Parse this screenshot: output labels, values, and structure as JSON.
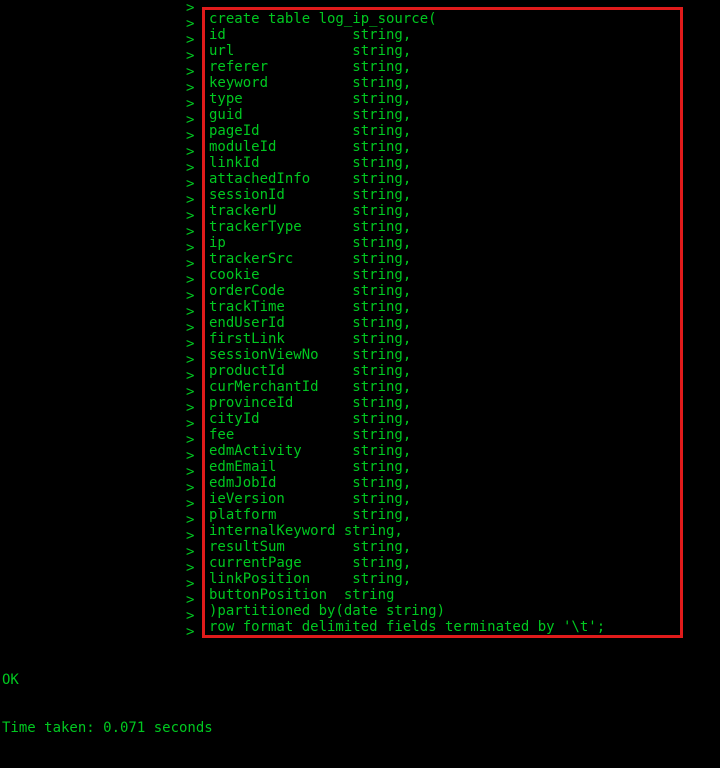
{
  "terminal": {
    "background_color": "#000000",
    "text_color": "#00c820",
    "highlight_color": "#e01b1b",
    "continuation_prompt": ">"
  },
  "sql": {
    "lines": [
      "create table log_ip_source(",
      "id               string,",
      "url              string,",
      "referer          string,",
      "keyword          string,",
      "type             string,",
      "guid             string,",
      "pageId           string,",
      "moduleId         string,",
      "linkId           string,",
      "attachedInfo     string,",
      "sessionId        string,",
      "trackerU         string,",
      "trackerType      string,",
      "ip               string,",
      "trackerSrc       string,",
      "cookie           string,",
      "orderCode        string,",
      "trackTime        string,",
      "endUserId        string,",
      "firstLink        string,",
      "sessionViewNo    string,",
      "productId        string,",
      "curMerchantId    string,",
      "provinceId       string,",
      "cityId           string,",
      "fee              string,",
      "edmActivity      string,",
      "edmEmail         string,",
      "edmJobId         string,",
      "ieVersion        string,",
      "platform         string,",
      "internalKeyword string,",
      "resultSum        string,",
      "currentPage      string,",
      "linkPosition     string,",
      "buttonPosition  string",
      ")partitioned by(date string)",
      "row format delimited fields terminated by '\\t';"
    ],
    "table_name": "log_ip_source",
    "column_type": "string",
    "partition_clause": ")partitioned by(date string)",
    "row_format_clause": "row format delimited fields terminated by '\\t';"
  },
  "result": {
    "status": "OK",
    "timing": "Time taken: 0.071 seconds"
  }
}
